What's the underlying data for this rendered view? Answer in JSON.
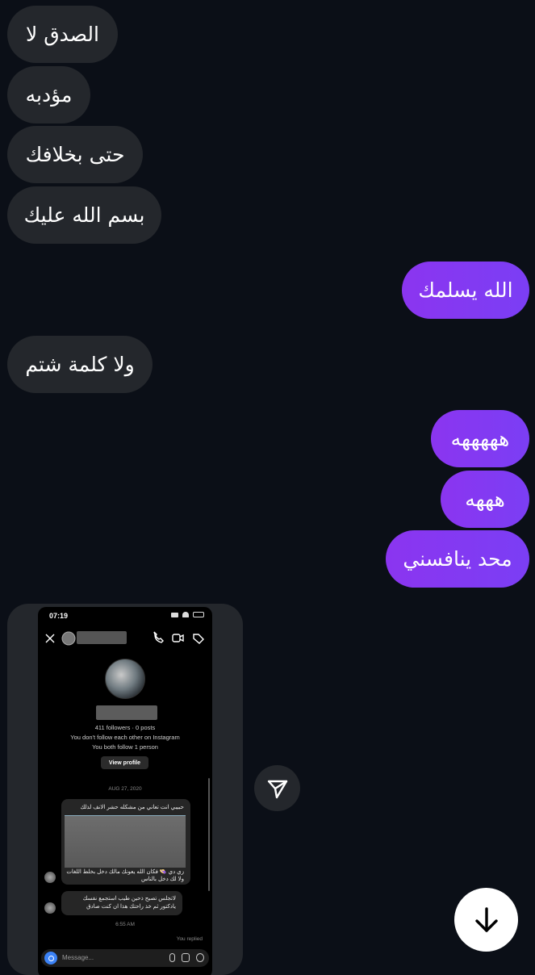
{
  "messages": [
    {
      "text": "الصدق لا",
      "side": "in"
    },
    {
      "text": "مؤدبه",
      "side": "in"
    },
    {
      "text": "حتى بخلافك",
      "side": "in"
    },
    {
      "text": "بسم الله عليك",
      "side": "in"
    },
    {
      "text": "الله يسلمك",
      "side": "out"
    },
    {
      "text": "ولا كلمة شتم",
      "side": "in"
    },
    {
      "text": "هههههه",
      "side": "out"
    },
    {
      "text": "هههه",
      "side": "out"
    },
    {
      "text": "محد ينافسني",
      "side": "out"
    }
  ],
  "shared_screenshot": {
    "status_time": "07:19",
    "followers_line": "411 followers · 0 posts",
    "follow_line1": "You don't follow each other on Instagram",
    "follow_line2": "You both follow 1 person",
    "view_profile": "View profile",
    "date": "AUG 27, 2020",
    "msg1_top": "حبيبي انت تعاني من مشكله حشر الانف لذلك",
    "msg1_bottom": "زي دي 👒 فكان الله يعونك مالك دخل بخلط اللغات ولا لك دخل بالناس",
    "msg2": "لاتجلس تصيح ذحين طيب استجمع نفسك يادكتور ثم خذ راحتك هذا ان كنت صادق",
    "time2": "6:55 AM",
    "replied": "You replied",
    "input_placeholder": "Message..."
  },
  "colors": {
    "background": "#0b0f17",
    "incoming": "#24272c",
    "outgoing": "#8b35f0"
  },
  "icons": {
    "share": "send-triangle-icon",
    "scroll_down": "arrow-down-icon"
  }
}
